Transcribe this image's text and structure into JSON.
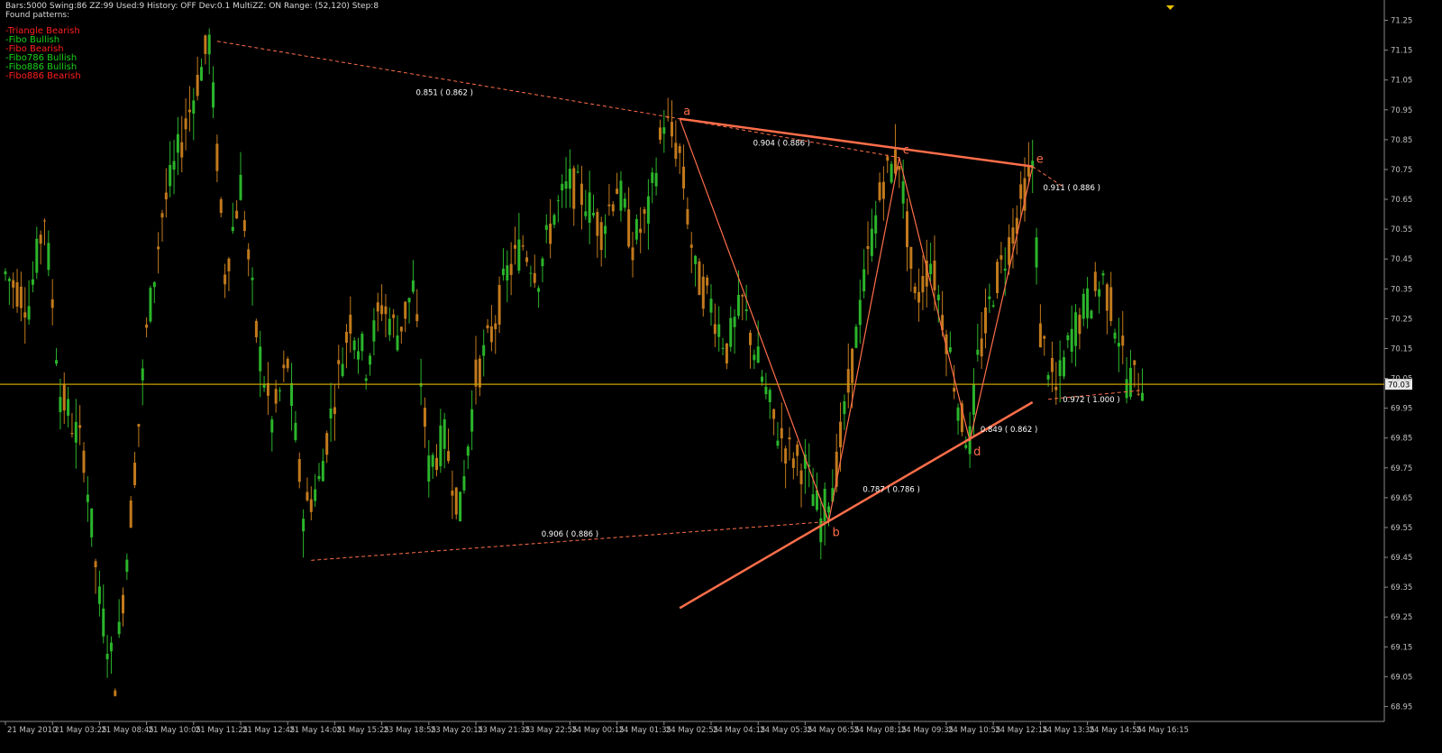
{
  "header": {
    "info": "Bars:5000  Swing:86  ZZ:99  Used:9  History: OFF Dev:0.1  MultiZZ: ON  Range: (52,120)  Step:8",
    "found_label": "Found patterns:"
  },
  "patterns": [
    {
      "label": "-Triangle Bearish",
      "kind": "bearish"
    },
    {
      "label": "-Fibo Bullish",
      "kind": "bullish"
    },
    {
      "label": "-Fibo Bearish",
      "kind": "bearish"
    },
    {
      "label": "-Fibo786 Bullish",
      "kind": "bullish"
    },
    {
      "label": "-Fibo886 Bullish",
      "kind": "bullish"
    },
    {
      "label": "-Fibo886 Bearish",
      "kind": "bearish"
    }
  ],
  "chart_data": {
    "type": "candlestick",
    "background": "#000000",
    "colors": {
      "bull": "#2bb52b",
      "bear": "#c27a1c",
      "pattern": "#ff6e4a",
      "current_price_line": "#c8a000",
      "axis_text": "#c0c0c0"
    },
    "ylim": [
      68.9,
      71.3
    ],
    "yticks": [
      "71.25",
      "71.15",
      "71.05",
      "70.95",
      "70.85",
      "70.75",
      "70.65",
      "70.55",
      "70.45",
      "70.35",
      "70.25",
      "70.15",
      "70.05",
      "69.95",
      "69.85",
      "69.75",
      "69.65",
      "69.55",
      "69.45",
      "69.35",
      "69.25",
      "69.15",
      "69.05",
      "68.95"
    ],
    "current_price": 70.03,
    "current_price_label": "70.03",
    "xticks": [
      "21 May 2010",
      "21 May 03:25",
      "21 May 08:45",
      "21 May 10:05",
      "21 May 11:25",
      "21 May 12:45",
      "21 May 14:05",
      "21 May 15:25",
      "23 May 18:55",
      "23 May 20:15",
      "23 May 21:35",
      "23 May 22:55",
      "24 May 00:15",
      "24 May 01:35",
      "24 May 02:55",
      "24 May 04:15",
      "24 May 05:35",
      "24 May 06:55",
      "24 May 08:15",
      "24 May 09:35",
      "24 May 10:55",
      "24 May 12:15",
      "24 May 13:35",
      "24 May 14:55",
      "24 May 16:15"
    ],
    "xtick_index": [
      0,
      6,
      12,
      18,
      24,
      30,
      36,
      42,
      48,
      54,
      60,
      66,
      72,
      78,
      84,
      90,
      96,
      102,
      108,
      114,
      120,
      126,
      132,
      138,
      144
    ],
    "price_path": [
      [
        0,
        70.4
      ],
      [
        3,
        70.3
      ],
      [
        5,
        70.6
      ],
      [
        7,
        70.0
      ],
      [
        10,
        69.8
      ],
      [
        12,
        69.3
      ],
      [
        14,
        69.05
      ],
      [
        16,
        69.6
      ],
      [
        18,
        70.2
      ],
      [
        20,
        70.6
      ],
      [
        22,
        70.8
      ],
      [
        24,
        71.0
      ],
      [
        26,
        71.18
      ],
      [
        28,
        70.4
      ],
      [
        30,
        70.7
      ],
      [
        32,
        70.2
      ],
      [
        34,
        69.9
      ],
      [
        36,
        70.1
      ],
      [
        38,
        69.6
      ],
      [
        40,
        69.7
      ],
      [
        42,
        70.0
      ],
      [
        44,
        70.25
      ],
      [
        46,
        70.1
      ],
      [
        48,
        70.3
      ],
      [
        50,
        70.2
      ],
      [
        52,
        70.35
      ],
      [
        54,
        69.75
      ],
      [
        56,
        69.85
      ],
      [
        58,
        69.6
      ],
      [
        60,
        70.05
      ],
      [
        62,
        70.2
      ],
      [
        64,
        70.4
      ],
      [
        66,
        70.5
      ],
      [
        68,
        70.4
      ],
      [
        70,
        70.6
      ],
      [
        72,
        70.7
      ],
      [
        74,
        70.65
      ],
      [
        76,
        70.55
      ],
      [
        78,
        70.7
      ],
      [
        80,
        70.5
      ],
      [
        82,
        70.6
      ],
      [
        84,
        70.92
      ],
      [
        86,
        70.8
      ],
      [
        88,
        70.4
      ],
      [
        90,
        70.3
      ],
      [
        92,
        70.15
      ],
      [
        94,
        70.3
      ],
      [
        96,
        70.1
      ],
      [
        98,
        69.9
      ],
      [
        100,
        69.8
      ],
      [
        102,
        69.75
      ],
      [
        104,
        69.57
      ],
      [
        106,
        69.75
      ],
      [
        108,
        70.1
      ],
      [
        110,
        70.45
      ],
      [
        112,
        70.72
      ],
      [
        114,
        70.79
      ],
      [
        116,
        70.3
      ],
      [
        118,
        70.45
      ],
      [
        120,
        70.2
      ],
      [
        122,
        69.9
      ],
      [
        123,
        69.84
      ],
      [
        124,
        70.1
      ],
      [
        126,
        70.35
      ],
      [
        128,
        70.5
      ],
      [
        130,
        70.68
      ],
      [
        131,
        70.76
      ],
      [
        132,
        70.2
      ],
      [
        134,
        70.0
      ],
      [
        136,
        70.2
      ],
      [
        138,
        70.3
      ],
      [
        140,
        70.38
      ],
      [
        142,
        70.2
      ],
      [
        143,
        70.05
      ],
      [
        145,
        70.04
      ]
    ],
    "pivots": [
      {
        "label": "a",
        "idx": 86,
        "price": 70.92
      },
      {
        "label": "b",
        "idx": 105,
        "price": 69.57
      },
      {
        "label": "c",
        "idx": 114,
        "price": 70.79
      },
      {
        "label": "d",
        "idx": 123,
        "price": 69.84
      },
      {
        "label": "e",
        "idx": 131,
        "price": 70.76
      }
    ],
    "ratios": [
      {
        "text": "0.851 ( 0.862 )",
        "idx": 56,
        "price": 71.0
      },
      {
        "text": "0.904 ( 0.886 )",
        "idx": 99,
        "price": 70.83
      },
      {
        "text": "0.911 ( 0.886 )",
        "idx": 136,
        "price": 70.68
      },
      {
        "text": "0.972 ( 1.000 )",
        "idx": 138.5,
        "price": 69.97
      },
      {
        "text": "0.849 ( 0.862 )",
        "idx": 128,
        "price": 69.87
      },
      {
        "text": "0.787 ( 0.786 )",
        "idx": 113,
        "price": 69.67
      },
      {
        "text": "0.906 ( 0.886 )",
        "idx": 72,
        "price": 69.52
      }
    ],
    "trendlines": [
      {
        "from": [
          86,
          70.92
        ],
        "to": [
          131,
          70.76
        ],
        "style": "solid"
      },
      {
        "from": [
          86,
          69.28
        ],
        "to": [
          131,
          69.97
        ],
        "style": "solid"
      }
    ],
    "dashed_lines": [
      {
        "from": [
          27,
          71.18
        ],
        "to": [
          86,
          70.92
        ]
      },
      {
        "from": [
          86,
          70.92
        ],
        "to": [
          114,
          70.79
        ]
      },
      {
        "from": [
          131,
          70.76
        ],
        "to": [
          135,
          70.69
        ]
      },
      {
        "from": [
          39,
          69.44
        ],
        "to": [
          105,
          69.57
        ]
      },
      {
        "from": [
          133,
          69.98
        ],
        "to": [
          145,
          70.01
        ]
      }
    ],
    "wave_path": [
      [
        86,
        70.92
      ],
      [
        105,
        69.57
      ],
      [
        114,
        70.79
      ],
      [
        123,
        69.84
      ],
      [
        131,
        70.76
      ]
    ]
  }
}
